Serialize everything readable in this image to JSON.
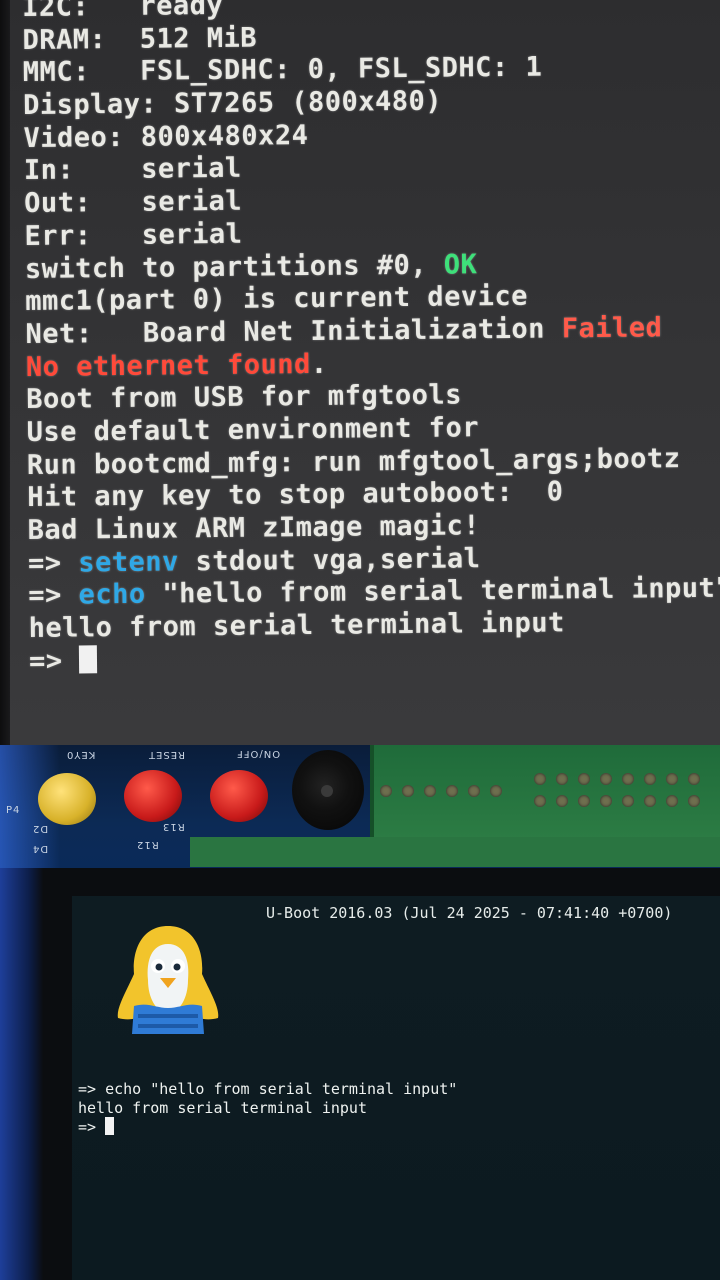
{
  "serial_terminal": {
    "lines": [
      {
        "parts": [
          {
            "text": "I2C:   ready"
          }
        ]
      },
      {
        "parts": [
          {
            "text": "DRAM:  512 MiB"
          }
        ]
      },
      {
        "parts": [
          {
            "text": "MMC:   FSL_SDHC: 0, FSL_SDHC: 1"
          }
        ]
      },
      {
        "parts": [
          {
            "text": "Display: ST7265 (800x480)"
          }
        ]
      },
      {
        "parts": [
          {
            "text": "Video: 800x480x24"
          }
        ]
      },
      {
        "parts": [
          {
            "text": "In:    serial"
          }
        ]
      },
      {
        "parts": [
          {
            "text": "Out:   serial"
          }
        ]
      },
      {
        "parts": [
          {
            "text": "Err:   serial"
          }
        ]
      },
      {
        "parts": [
          {
            "text": "switch to partitions #0, "
          },
          {
            "text": "OK",
            "style": "ok"
          }
        ]
      },
      {
        "parts": [
          {
            "text": "mmc1(part 0) is current device"
          }
        ]
      },
      {
        "parts": [
          {
            "text": "Net:   Board Net Initialization "
          },
          {
            "text": "Failed",
            "style": "failed"
          }
        ]
      },
      {
        "parts": [
          {
            "text": "No ethernet found",
            "style": "red"
          },
          {
            "text": "."
          }
        ]
      },
      {
        "parts": [
          {
            "text": "Boot from USB for mfgtools"
          }
        ]
      },
      {
        "parts": [
          {
            "text": "Use default environment for"
          }
        ]
      },
      {
        "parts": [
          {
            "text": "Run bootcmd_mfg: run mfgtool_args;bootz"
          }
        ]
      },
      {
        "parts": [
          {
            "text": "Hit any key to stop autoboot:  0"
          }
        ]
      },
      {
        "parts": [
          {
            "text": "Bad Linux ARM zImage magic!"
          }
        ]
      },
      {
        "parts": [
          {
            "text": "=> "
          },
          {
            "text": "setenv",
            "style": "cyan"
          },
          {
            "text": " stdout vga,serial"
          }
        ]
      },
      {
        "parts": [
          {
            "text": "=> "
          },
          {
            "text": "echo",
            "style": "cyan"
          },
          {
            "text": " \"hello from serial terminal input\""
          }
        ]
      },
      {
        "parts": [
          {
            "text": "hello from serial terminal input"
          }
        ]
      },
      {
        "parts": [
          {
            "text": "=> "
          }
        ],
        "cursor": true
      }
    ]
  },
  "board": {
    "labels": [
      "KEY0",
      "RESET",
      "ON/OFF",
      "P4",
      "D2",
      "D4",
      "R12",
      "R13"
    ]
  },
  "lcd": {
    "header": "U-Boot 2016.03 (Jul 24 2025 - 07:41:40 +0700)",
    "lines": [
      {
        "text": "=> echo \"hello from serial terminal input\""
      },
      {
        "text": "hello from serial terminal input"
      },
      {
        "text": "=> ",
        "cursor": true
      }
    ]
  },
  "colors": {
    "ok": "#3ee07a",
    "failed": "#ff5a4a",
    "cyan_command": "#2fa8e6",
    "terminal_text": "#e9e9e4"
  }
}
